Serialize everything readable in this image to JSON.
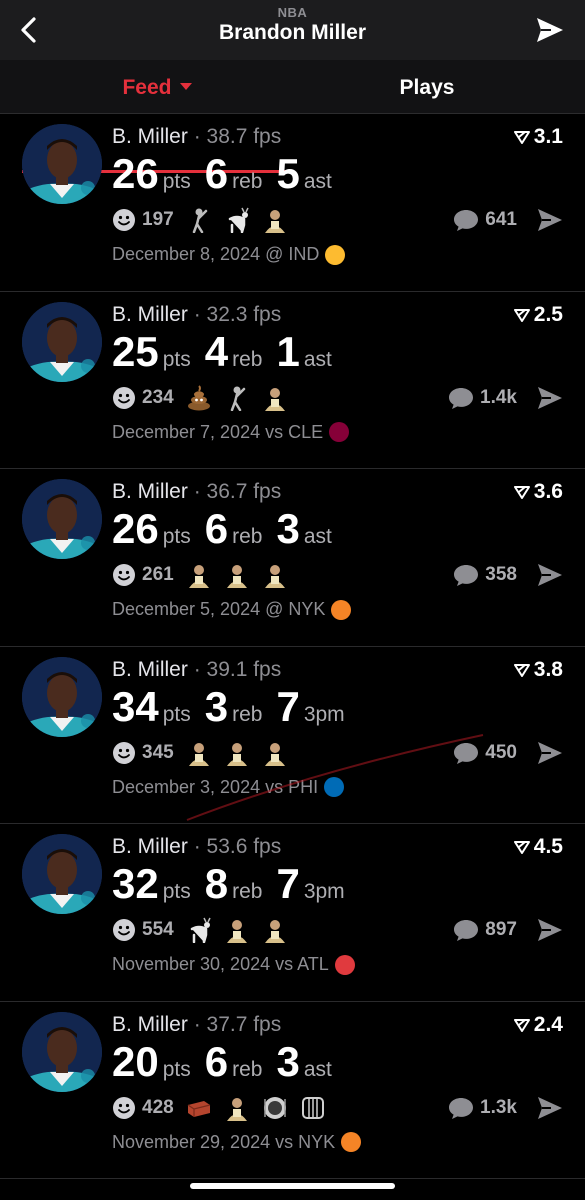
{
  "header": {
    "league": "NBA",
    "title": "Brandon Miller"
  },
  "tabs": [
    {
      "label": "Feed",
      "active": true
    },
    {
      "label": "Plays",
      "active": false
    }
  ],
  "colors": {
    "accent": "#e5303c",
    "background": "#000000",
    "muted": "#8e8e93"
  },
  "cards": [
    {
      "player": "B. Miller",
      "fps": "· 38.7 fps",
      "score": "3.1",
      "stats": [
        {
          "num": "26",
          "label": "pts"
        },
        {
          "num": "6",
          "label": "reb"
        },
        {
          "num": "5",
          "label": "ast"
        }
      ],
      "reactions": "197",
      "emoji_icons": [
        "golfer-icon",
        "goat-icon",
        "player-photo-icon"
      ],
      "comments": "641",
      "date": "December 8, 2024 @ IND",
      "opponent_logo": "pacers-logo",
      "logo_color": "#fdbb30"
    },
    {
      "player": "B. Miller",
      "fps": "· 32.3 fps",
      "score": "2.5",
      "stats": [
        {
          "num": "25",
          "label": "pts"
        },
        {
          "num": "4",
          "label": "reb"
        },
        {
          "num": "1",
          "label": "ast"
        }
      ],
      "reactions": "234",
      "emoji_icons": [
        "poop-icon",
        "golfer-icon",
        "player-photo-icon"
      ],
      "comments": "1.4k",
      "date": "December 7, 2024 vs CLE",
      "opponent_logo": "cavaliers-logo",
      "logo_color": "#860038"
    },
    {
      "player": "B. Miller",
      "fps": "· 36.7 fps",
      "score": "3.6",
      "stats": [
        {
          "num": "26",
          "label": "pts"
        },
        {
          "num": "6",
          "label": "reb"
        },
        {
          "num": "3",
          "label": "ast"
        }
      ],
      "reactions": "261",
      "emoji_icons": [
        "player-photo-icon",
        "player-photo-icon",
        "player-photo-icon"
      ],
      "comments": "358",
      "date": "December 5, 2024 @ NYK",
      "opponent_logo": "knicks-logo",
      "logo_color": "#f58426"
    },
    {
      "player": "B. Miller",
      "fps": "· 39.1 fps",
      "score": "3.8",
      "stats": [
        {
          "num": "34",
          "label": "pts"
        },
        {
          "num": "3",
          "label": "reb"
        },
        {
          "num": "7",
          "label": "3pm"
        }
      ],
      "reactions": "345",
      "emoji_icons": [
        "player-photo-icon",
        "player-photo-icon",
        "player-photo-icon"
      ],
      "comments": "450",
      "date": "December 3, 2024 vs PHI",
      "opponent_logo": "sixers-logo",
      "logo_color": "#006bb6"
    },
    {
      "player": "B. Miller",
      "fps": "· 53.6 fps",
      "score": "4.5",
      "stats": [
        {
          "num": "32",
          "label": "pts"
        },
        {
          "num": "8",
          "label": "reb"
        },
        {
          "num": "7",
          "label": "3pm"
        }
      ],
      "reactions": "554",
      "emoji_icons": [
        "goat-icon",
        "player-photo-icon",
        "player-photo-icon"
      ],
      "comments": "897",
      "date": "November 30, 2024 vs ATL",
      "opponent_logo": "hawks-logo",
      "logo_color": "#e03a3e"
    },
    {
      "player": "B. Miller",
      "fps": "· 37.7 fps",
      "score": "2.4",
      "stats": [
        {
          "num": "20",
          "label": "pts"
        },
        {
          "num": "6",
          "label": "reb"
        },
        {
          "num": "3",
          "label": "ast"
        }
      ],
      "reactions": "428",
      "emoji_icons": [
        "brick-icon",
        "player-photo-icon",
        "plate-icon",
        "cage-icon"
      ],
      "comments": "1.3k",
      "date": "November 29, 2024 vs NYK",
      "opponent_logo": "knicks-logo",
      "logo_color": "#f58426"
    }
  ]
}
